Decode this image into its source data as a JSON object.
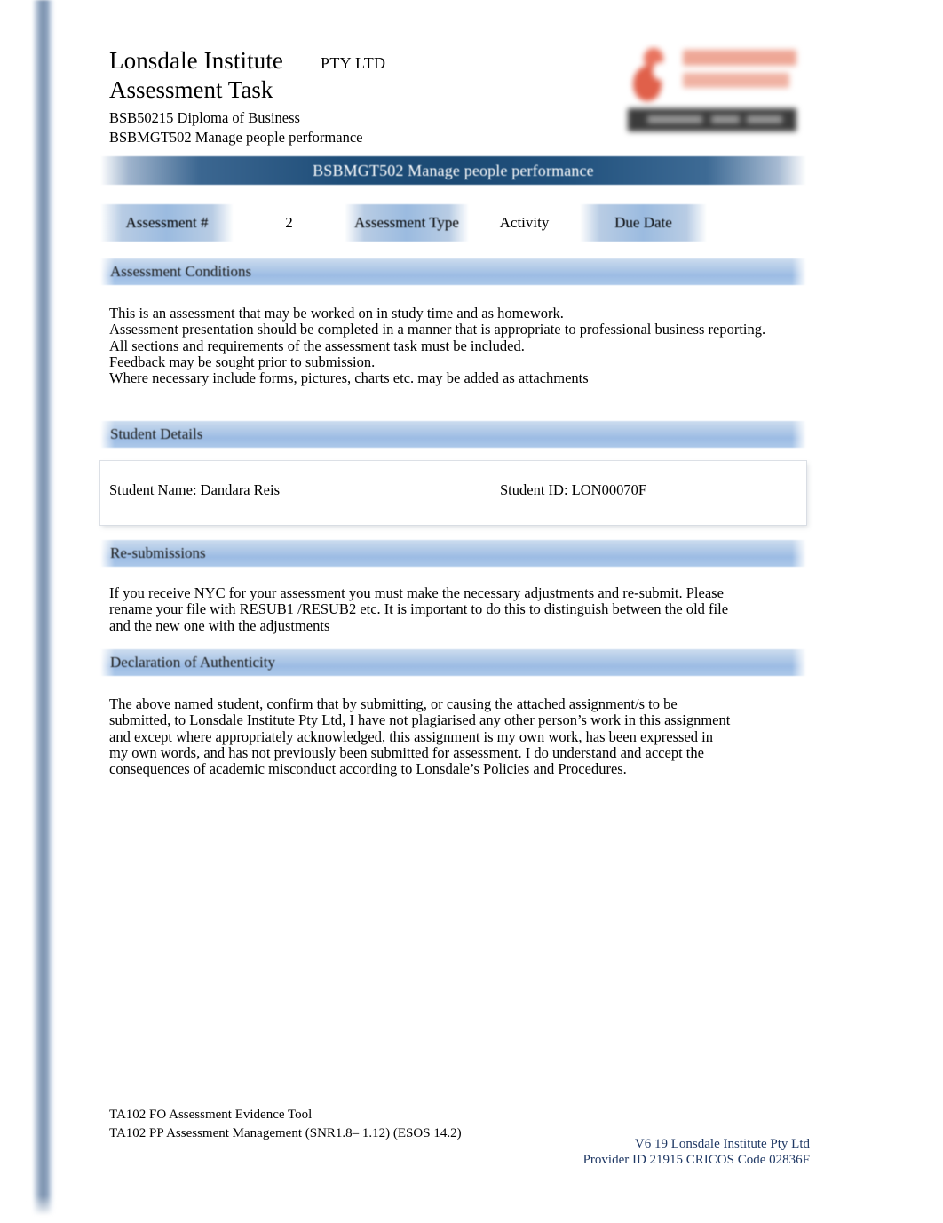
{
  "header": {
    "institute_name": "Lonsdale Institute",
    "pty_ltd": "PTY LTD",
    "task_title": "Assessment Task",
    "course_code": "BSB50215 Diploma of Business",
    "unit_code": "BSBMGT502 Manage people performance"
  },
  "logo": {
    "name": "lonsdale-institute-logo"
  },
  "banner": {
    "label": "BSBMGT502 Manage people performance"
  },
  "meta": {
    "assessment_number_label": "Assessment #",
    "assessment_number_value": "2",
    "assessment_type_label": "Assessment Type",
    "assessment_type_value": "Activity",
    "due_date_label": "Due Date",
    "due_date_value": ""
  },
  "sections": {
    "conditions": {
      "title": "Assessment Conditions",
      "lines": [
        "This is an assessment that may be worked on in study time and as homework.",
        "Assessment presentation should be completed in a manner that is appropriate to professional business reporting.",
        "All sections and requirements of the assessment task must be included.",
        "Feedback may be sought prior to submission.",
        "Where necessary include forms, pictures, charts etc. may be added as attachments"
      ]
    },
    "student_details": {
      "title": "Student Details",
      "student_name": "Student Name: Dandara Reis",
      "student_id": "Student ID: LON00070F"
    },
    "resubmissions": {
      "title": "Re-submissions",
      "text": "If you receive NYC for your assessment you must make the necessary adjustments and re-submit. Please rename your file with RESUB1 /RESUB2 etc. It is important to do this to distinguish between the old file and the new one with the adjustments"
    },
    "declaration": {
      "title": "Declaration of Authenticity",
      "text": "The above named student, confirm that by submitting, or causing the attached assignment/s to be submitted, to Lonsdale Institute Pty Ltd, I have not plagiarised any other person’s work in this assignment and except where appropriately acknowledged, this assignment is my own work, has been expressed in my own words, and has not previously been submitted for assessment. I do understand and accept the consequences of academic misconduct according to Lonsdale’s Policies and Procedures."
    }
  },
  "footer": {
    "left_line_1": "TA102 FO Assessment Evidence Tool",
    "left_line_2": "TA102 PP Assessment Management (SNR1.8– 1.12) (ESOS 14.2)",
    "right_line_1": "V6 19 Lonsdale Institute Pty Ltd",
    "right_line_2": "Provider ID 21915 CRICOS Code 02836F"
  },
  "colors": {
    "banner_navy": "#1f4e79",
    "section_blue": "#9cbce4",
    "meta_cell_blue": "#9bbbe0",
    "footer_blue": "#1f3864",
    "logo_red": "#e0604a",
    "stripe_blue": "#7e93af"
  }
}
